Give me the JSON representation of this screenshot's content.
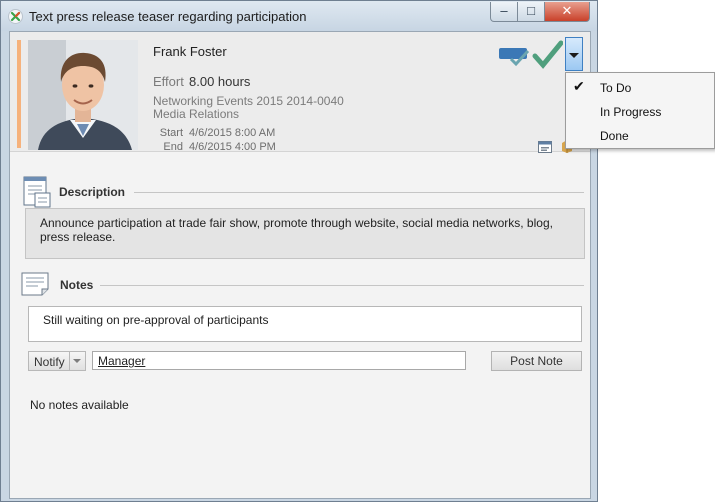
{
  "window": {
    "title": "Text press release teaser regarding participation",
    "min_label": "–",
    "max_label": "□",
    "close_label": "✕"
  },
  "task": {
    "assignee": "Frank Foster",
    "effort_label": "Effort",
    "effort_value": "8.00 hours",
    "project": "Networking Events 2015 2014-0040",
    "topic": "Media Relations",
    "start_label": "Start",
    "start_value": "4/6/2015 8:00 AM",
    "end_label": "End",
    "end_value": "4/6/2015 4:00 PM",
    "accent_color": "#f6b27c"
  },
  "status_menu": {
    "items": [
      {
        "label": "To Do",
        "checked": true
      },
      {
        "label": "In Progress",
        "checked": false
      },
      {
        "label": "Done",
        "checked": false
      }
    ]
  },
  "description": {
    "heading": "Description",
    "text": "Announce participation at trade fair show, promote through website, social media networks, blog, press release."
  },
  "notes": {
    "heading": "Notes",
    "input_value": "Still waiting on pre-approval of participants",
    "notify_label": "Notify",
    "recipient": "Manager",
    "post_label": "Post Note",
    "empty_text": "No notes available"
  },
  "icons": [
    "app-x-icon",
    "assigned-check-icon",
    "complete-check-icon",
    "chevron-down-icon",
    "calendar-icon",
    "package-icon",
    "description-doc-icon",
    "notes-doc-icon",
    "check-icon"
  ]
}
